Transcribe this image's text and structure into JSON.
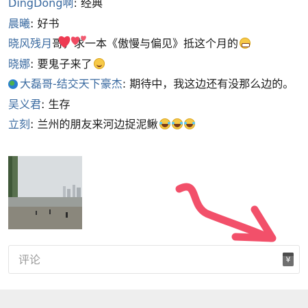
{
  "comments": [
    {
      "name": "DingDong啊",
      "sep": ": ",
      "text": "经典"
    },
    {
      "name": "晨曦",
      "sep": ": ",
      "text": "好书"
    },
    {
      "name": "晓风残月",
      "sep": "",
      "text": "哥，求一本《傲慢与偏见》抵这个月的",
      "emoji": "grin-emoji-icon"
    },
    {
      "name": "晓娜",
      "sep": ": ",
      "text": "要鬼子来了",
      "emoji": "smile-emoji-icon"
    },
    {
      "name": "大磊哥-结交天下豪杰",
      "sep": ": ",
      "text": "期待中，我这边还有没那么边的。",
      "prefix_icon": "globe-icon"
    },
    {
      "name": "吴义君",
      "sep": ": ",
      "text": "生存"
    },
    {
      "name": "立刻",
      "sep": ": ",
      "text": "兰州的朋友来河边捉泥鳅",
      "emoji": "laugh-emoji-icon",
      "emoji_count": 3
    }
  ],
  "photo": {
    "icon": "river-photo"
  },
  "annotation": {
    "icon": "red-arrow-annotation",
    "color": "#f2506a"
  },
  "comment_bar": {
    "placeholder": "评论",
    "reward_icon": "yuan-envelope-icon",
    "reward_symbol": "¥"
  },
  "colors": {
    "name": "#3a6aa0",
    "text": "#1a1a1a",
    "footer": "#eeeeee"
  }
}
